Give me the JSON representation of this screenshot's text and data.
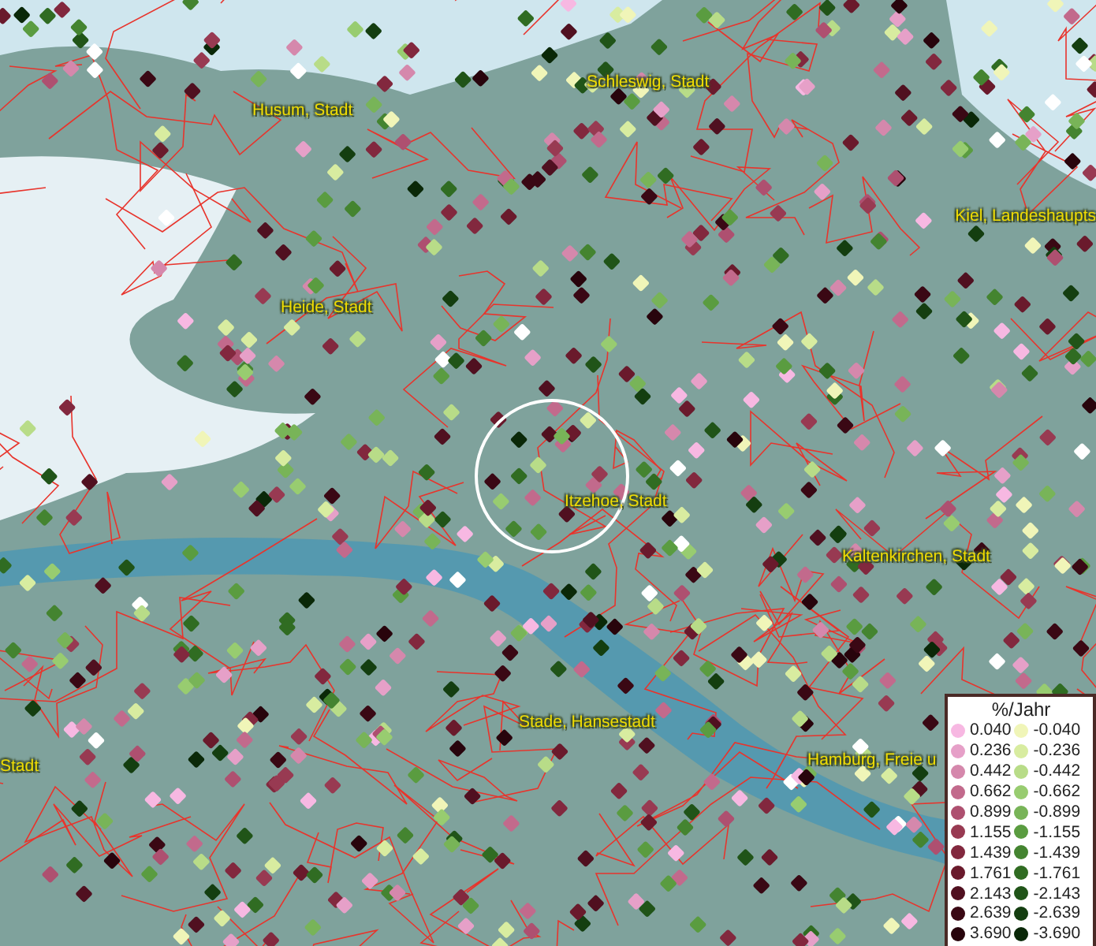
{
  "map": {
    "places": [
      {
        "label": "Husum, Stadt"
      },
      {
        "label": "Schleswig, Stadt"
      },
      {
        "label": "Kiel, Landeshaupts"
      },
      {
        "label": "Heide, Stadt"
      },
      {
        "label": "Itzehoe, Stadt"
      },
      {
        "label": "Kaltenkirchen, Stadt"
      },
      {
        "label": "Stade, Hansestadt"
      },
      {
        "label": "Stadt"
      },
      {
        "label": "Hamburg, Freie u"
      }
    ]
  },
  "legend": {
    "title": "%/Jahr",
    "positive": [
      {
        "value": "0.040",
        "color": "#f7b8e2"
      },
      {
        "value": "0.236",
        "color": "#e6a0c8"
      },
      {
        "value": "0.442",
        "color": "#d588ac"
      },
      {
        "value": "0.662",
        "color": "#c26a8c"
      },
      {
        "value": "0.899",
        "color": "#ae5070"
      },
      {
        "value": "1.155",
        "color": "#983a52"
      },
      {
        "value": "1.439",
        "color": "#82283e"
      },
      {
        "value": "1.761",
        "color": "#6a1a2c"
      },
      {
        "value": "2.143",
        "color": "#501020"
      },
      {
        "value": "2.639",
        "color": "#3a0814"
      },
      {
        "value": "3.690",
        "color": "#28040c"
      }
    ],
    "negative": [
      {
        "value": "-0.040",
        "color": "#f0f5b8"
      },
      {
        "value": "-0.236",
        "color": "#d8eca0"
      },
      {
        "value": "-0.442",
        "color": "#b8dc88"
      },
      {
        "value": "-0.662",
        "color": "#98cc70"
      },
      {
        "value": "-0.899",
        "color": "#78b458"
      },
      {
        "value": "-1.155",
        "color": "#5a9c40"
      },
      {
        "value": "-1.439",
        "color": "#448430"
      },
      {
        "value": "-1.761",
        "color": "#306c22"
      },
      {
        "value": "-2.143",
        "color": "#205418"
      },
      {
        "value": "-2.639",
        "color": "#143e10"
      },
      {
        "value": "-3.690",
        "color": "#0a2808"
      }
    ]
  }
}
